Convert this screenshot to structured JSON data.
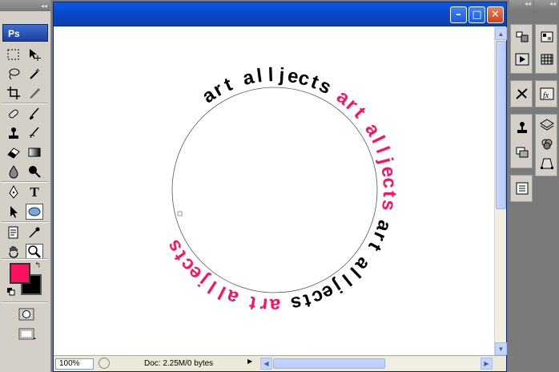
{
  "app": {
    "logo": "Ps",
    "grip_glyph": "◂◂"
  },
  "tools": [
    {
      "name": "marquee-icon"
    },
    {
      "name": "move-icon"
    },
    {
      "name": "lasso-icon"
    },
    {
      "name": "magic-wand-icon"
    },
    {
      "name": "crop-icon"
    },
    {
      "name": "slice-icon"
    },
    {
      "name": "healing-brush-icon"
    },
    {
      "name": "brush-icon"
    },
    {
      "name": "clone-stamp-icon"
    },
    {
      "name": "history-brush-icon"
    },
    {
      "name": "eraser-icon"
    },
    {
      "name": "gradient-icon"
    },
    {
      "name": "blur-icon"
    },
    {
      "name": "dodge-icon"
    },
    {
      "name": "pen-icon"
    },
    {
      "name": "type-icon"
    },
    {
      "name": "path-selection-icon"
    },
    {
      "name": "ellipse-shape-icon"
    },
    {
      "name": "notes-icon"
    },
    {
      "name": "eyedropper-icon"
    },
    {
      "name": "hand-icon"
    },
    {
      "name": "zoom-icon"
    }
  ],
  "type_tool_glyph": "T",
  "colors": {
    "foreground": "#ff1160",
    "background": "#000000",
    "swap_glyph": "↰"
  },
  "document": {
    "window_controls": {
      "minimize": "–",
      "maximize": "□",
      "close": "✕"
    },
    "artwork": {
      "words": [
        {
          "text": "art",
          "color": "#000000"
        },
        {
          "text": "alljects",
          "color": "#000000"
        },
        {
          "text": "art",
          "color": "#ff1160"
        },
        {
          "text": "alljects",
          "color": "#ff1160"
        },
        {
          "text": "art",
          "color": "#000000"
        },
        {
          "text": "alljects",
          "color": "#000000"
        },
        {
          "text": "art",
          "color": "#ff1160"
        },
        {
          "text": "alljects",
          "color": "#ff1160"
        }
      ]
    },
    "status": {
      "zoom": "100%",
      "doc_info": "Doc: 2.25M/0 bytes",
      "arrow_glyph": "▶"
    },
    "scroll_glyphs": {
      "up": "▲",
      "down": "▼",
      "left": "◀",
      "right": "▶"
    }
  },
  "panels_left": [
    {
      "name": "navigator-panel-icon"
    },
    {
      "name": "actions-panel-icon"
    },
    {
      "name": "tool-presets-panel-icon"
    },
    {
      "name": "clone-source-panel-icon"
    },
    {
      "name": "layer-comps-panel-icon"
    },
    {
      "name": "notes-panel-icon"
    }
  ],
  "panels_right": [
    {
      "name": "color-panel-icon"
    },
    {
      "name": "swatches-panel-icon"
    },
    {
      "name": "styles-panel-icon"
    },
    {
      "name": "layers-panel-icon"
    },
    {
      "name": "channels-panel-icon"
    },
    {
      "name": "paths-panel-icon"
    }
  ]
}
